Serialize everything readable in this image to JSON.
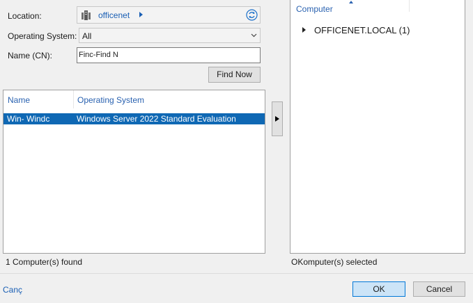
{
  "search": {
    "location_label": "Location:",
    "location_value": "officenet",
    "os_label": "Operating System:",
    "os_value": "All",
    "name_label": "Name (CN):",
    "name_value": "Finc-Find N",
    "find_now_label": "Find Now"
  },
  "results": {
    "columns": [
      "Name",
      "Operating System"
    ],
    "rows": [
      {
        "name": "Win- Windc",
        "os": "Windows Server 2022 Standard Evaluation",
        "selected": true
      }
    ],
    "status": "1 Computer(s) found"
  },
  "selected_panel": {
    "column": "Computer",
    "tree_node": "OFFICENET.LOCAL (1)",
    "status": "OKomputer(s) selected"
  },
  "footer": {
    "cancel_link": "Canç",
    "ok_label": "OK",
    "cancel_label": "Cancel"
  },
  "colors": {
    "accent": "#0f68b4",
    "link": "#1a5fb4",
    "header_text": "#2a62b0",
    "ok_bg": "#cce4f7"
  },
  "icons": [
    "server-icon",
    "chevron-right-icon",
    "refresh-icon",
    "chevron-down-icon",
    "move-right-icon",
    "tree-expand-icon",
    "sort-asc-icon"
  ]
}
